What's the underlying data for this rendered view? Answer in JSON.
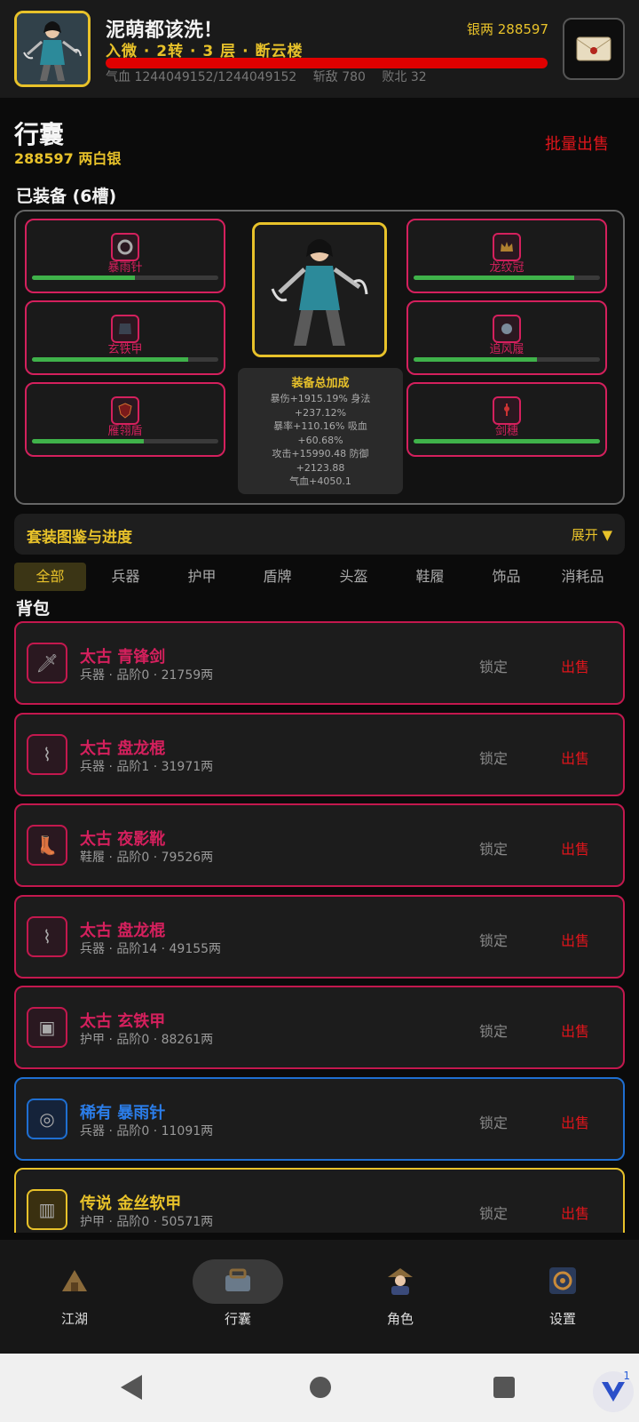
{
  "header": {
    "player_name": "泥萌都该洗！",
    "silver_label": "银两 288597",
    "realm": "入微 · 2转 · 3 层 · 断云楼",
    "hp_fraction": 1.0,
    "hp_text": "气血 1244049152/1244049152",
    "kills_text": "斩敌 780",
    "defeats_text": "败北 32"
  },
  "bag": {
    "title": "行囊",
    "silver": "288597 两白银",
    "bulk_sell": "批量出售"
  },
  "equipped": {
    "title": "已装备 (6槽)",
    "slots": [
      {
        "label": "暴雨针",
        "icon": "needle-icon",
        "durability": 0.55
      },
      {
        "label": "玄铁甲",
        "icon": "armor-icon",
        "durability": 0.84
      },
      {
        "label": "雁翎盾",
        "icon": "shield-icon",
        "durability": 0.6
      },
      {
        "label": "龙纹冠",
        "icon": "crown-icon",
        "durability": 0.86
      },
      {
        "label": "追风履",
        "icon": "boots-icon",
        "durability": 0.66
      },
      {
        "label": "剑穗",
        "icon": "tassel-icon",
        "durability": 1.0
      }
    ],
    "bonus_title": "装备总加成",
    "bonus_lines": [
      "暴伤+1915.19% 身法",
      "+237.12%",
      "暴率+110.16% 吸血",
      "+60.68%",
      "攻击+15990.48 防御",
      "+2123.88",
      "气血+4050.1"
    ]
  },
  "set_collection": {
    "title": "套装图鉴与进度",
    "expand": "展开 ▼"
  },
  "tabs": [
    "全部",
    "兵器",
    "护甲",
    "盾牌",
    "头盔",
    "鞋履",
    "饰品",
    "消耗品"
  ],
  "pack": {
    "title": "背包",
    "lock_label": "锁定",
    "sell_label": "出售",
    "items": [
      {
        "name": "太古 青锋剑",
        "meta": "兵器 · 品阶0 · 21759两",
        "rarity": "ancient",
        "icon": "sword-icon"
      },
      {
        "name": "太古 盘龙棍",
        "meta": "兵器 · 品阶1 · 31971两",
        "rarity": "ancient",
        "icon": "staff-icon"
      },
      {
        "name": "太古 夜影靴",
        "meta": "鞋履 · 品阶0 · 79526两",
        "rarity": "ancient",
        "icon": "boots-icon"
      },
      {
        "name": "太古 盘龙棍",
        "meta": "兵器 · 品阶14 · 49155两",
        "rarity": "ancient",
        "icon": "staff-icon"
      },
      {
        "name": "太古 玄铁甲",
        "meta": "护甲 · 品阶0 · 88261两",
        "rarity": "ancient",
        "icon": "armor-icon"
      },
      {
        "name": "稀有 暴雨针",
        "meta": "兵器 · 品阶0 · 11091两",
        "rarity": "rare",
        "icon": "needle-icon"
      },
      {
        "name": "传说 金丝软甲",
        "meta": "护甲 · 品阶0 · 50571两",
        "rarity": "legend",
        "icon": "vest-icon"
      }
    ]
  },
  "nav": [
    {
      "label": "江湖",
      "icon": "jianghu-icon"
    },
    {
      "label": "行囊",
      "icon": "bag-icon"
    },
    {
      "label": "角色",
      "icon": "character-icon"
    },
    {
      "label": "设置",
      "icon": "settings-icon"
    }
  ],
  "system": {
    "badge_count": "1"
  },
  "colors": {
    "gold": "#e8c22a",
    "ancient": "#d4205d",
    "rare": "#2b7de9",
    "sell_red": "#e0151b",
    "durability_green": "#3fb24a"
  }
}
